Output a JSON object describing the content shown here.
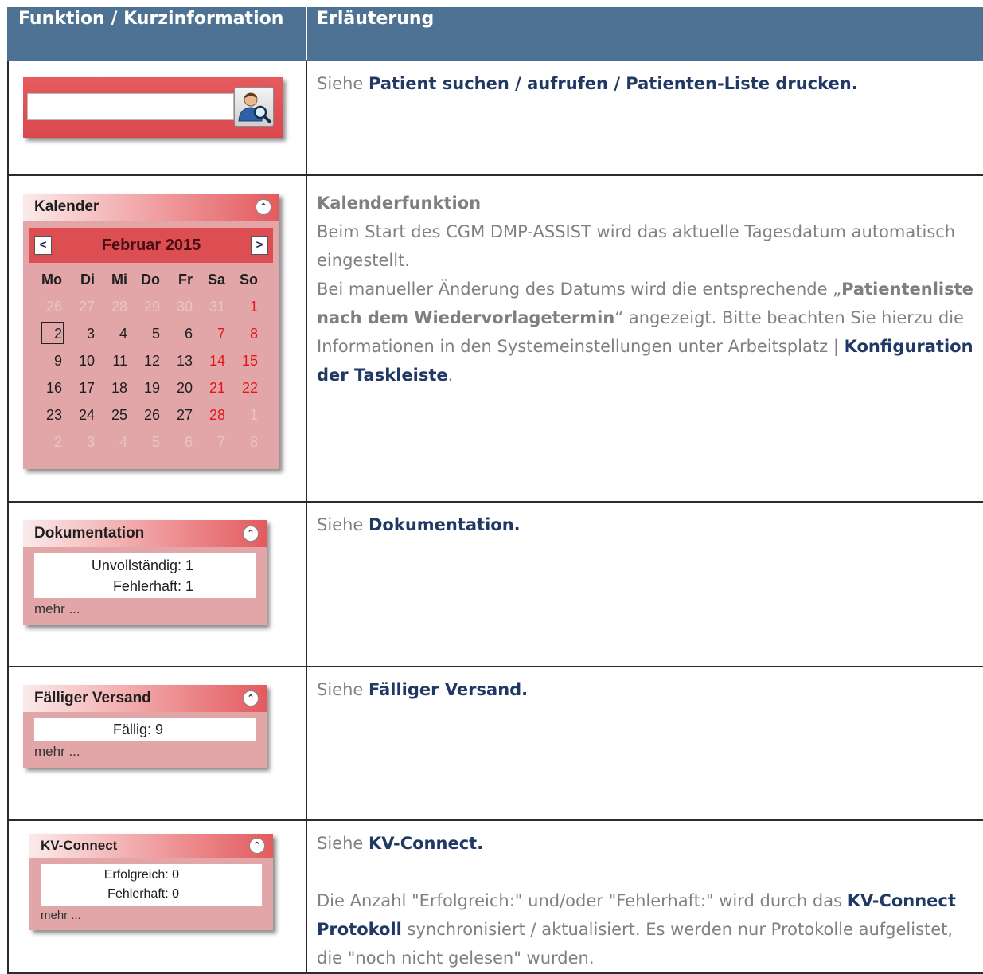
{
  "table": {
    "col1_header": "Funktion / Kurzinformation",
    "col2_header": "Erläuterung"
  },
  "rows": {
    "search": {
      "pre": "Siehe ",
      "link": "Patient suchen / aufrufen / Patienten-Liste drucken."
    },
    "calendar": {
      "widget_title": "Kalender",
      "month": "Februar 2015",
      "prev": "<",
      "next": ">",
      "desc_title": "Kalenderfunktion",
      "desc_l1": "Beim Start des CGM DMP-ASSIST wird das aktuelle Tagesdatum automatisch eingestellt.",
      "desc_l2a": "Bei manueller Änderung des Datums wird die entsprechende „",
      "desc_l2b": "Patientenliste nach dem Wiedervorlagetermin",
      "desc_l2c": "“ angezeigt. Bitte beachten Sie hierzu die Informationen in den Systemeinstellungen unter Arbeitsplatz | ",
      "desc_l2d": "Konfiguration der Taskleiste",
      "desc_l2e": "."
    },
    "doku": {
      "widget_title": "Dokumentation",
      "line1": "Unvollständig: 1",
      "line2": "Fehlerhaft: 1",
      "more": "mehr ...",
      "pre": "Siehe ",
      "link": "Dokumentation."
    },
    "versand": {
      "widget_title": "Fälliger Versand",
      "line1": "Fällig: 9",
      "more": "mehr ...",
      "pre": "Siehe ",
      "link": "Fälliger Versand."
    },
    "kv": {
      "widget_title": "KV-Connect",
      "line1": "Erfolgreich: 0",
      "line2": "Fehlerhaft: 0",
      "more": "mehr ...",
      "pre": "Siehe ",
      "link": "KV-Connect.",
      "p2a": "Die Anzahl \"Erfolgreich:\" und/oder \"Fehlerhaft:\" wird durch das ",
      "p2b": "KV-Connect Protokoll",
      "p2c": " synchronisiert / aktualisiert. Es werden nur Protokolle aufgelistet, die \"noch nicht gelesen\" wurden."
    }
  },
  "calendar_grid": {
    "weekdays": [
      "Mo",
      "Di",
      "Mi",
      "Do",
      "Fr",
      "Sa",
      "So"
    ],
    "weeks": [
      [
        {
          "d": "26",
          "s": "muted"
        },
        {
          "d": "27",
          "s": "muted"
        },
        {
          "d": "28",
          "s": "muted"
        },
        {
          "d": "29",
          "s": "muted"
        },
        {
          "d": "30",
          "s": "muted"
        },
        {
          "d": "31",
          "s": "muted"
        },
        {
          "d": "1",
          "s": "red"
        }
      ],
      [
        {
          "d": "2",
          "s": "today"
        },
        {
          "d": "3",
          "s": ""
        },
        {
          "d": "4",
          "s": ""
        },
        {
          "d": "5",
          "s": ""
        },
        {
          "d": "6",
          "s": ""
        },
        {
          "d": "7",
          "s": "red"
        },
        {
          "d": "8",
          "s": "red"
        }
      ],
      [
        {
          "d": "9",
          "s": ""
        },
        {
          "d": "10",
          "s": ""
        },
        {
          "d": "11",
          "s": ""
        },
        {
          "d": "12",
          "s": ""
        },
        {
          "d": "13",
          "s": ""
        },
        {
          "d": "14",
          "s": "red"
        },
        {
          "d": "15",
          "s": "red"
        }
      ],
      [
        {
          "d": "16",
          "s": ""
        },
        {
          "d": "17",
          "s": ""
        },
        {
          "d": "18",
          "s": ""
        },
        {
          "d": "19",
          "s": ""
        },
        {
          "d": "20",
          "s": ""
        },
        {
          "d": "21",
          "s": "red"
        },
        {
          "d": "22",
          "s": "red"
        }
      ],
      [
        {
          "d": "23",
          "s": ""
        },
        {
          "d": "24",
          "s": ""
        },
        {
          "d": "25",
          "s": ""
        },
        {
          "d": "26",
          "s": ""
        },
        {
          "d": "27",
          "s": ""
        },
        {
          "d": "28",
          "s": "red"
        },
        {
          "d": "1",
          "s": "muted"
        }
      ],
      [
        {
          "d": "2",
          "s": "muted"
        },
        {
          "d": "3",
          "s": "muted"
        },
        {
          "d": "4",
          "s": "muted"
        },
        {
          "d": "5",
          "s": "muted"
        },
        {
          "d": "6",
          "s": "muted"
        },
        {
          "d": "7",
          "s": "muted"
        },
        {
          "d": "8",
          "s": "muted"
        }
      ]
    ]
  },
  "icons": {
    "search_button": "patient-search-icon",
    "collapse": "collapse-icon"
  }
}
